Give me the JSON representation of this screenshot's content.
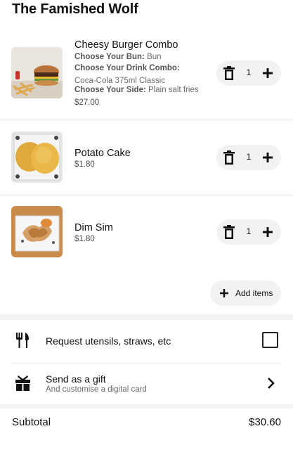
{
  "store": {
    "title": "The Famished Wolf"
  },
  "cart": {
    "items": [
      {
        "name": "Cheesy Burger Combo",
        "options": [
          {
            "label": "Choose Your Bun:",
            "value": "Bun"
          },
          {
            "label": "Choose Your Drink Combo:",
            "value": "Coca-Cola 375ml Classic"
          },
          {
            "label": "Choose Your Side:",
            "value": "Plain salt fries"
          }
        ],
        "price": "$27.00",
        "quantity": "1",
        "image_icon": "burger-photo"
      },
      {
        "name": "Potato Cake",
        "price": "$1.80",
        "quantity": "1",
        "image_icon": "potato-cake-photo"
      },
      {
        "name": "Dim Sim",
        "price": "$1.80",
        "quantity": "1",
        "image_icon": "dim-sim-photo"
      }
    ],
    "add_items_label": "Add items"
  },
  "extras": {
    "utensils": {
      "title": "Request utensils, straws, etc",
      "checked": false,
      "icon": "utensils-icon"
    },
    "gift": {
      "title": "Send as a gift",
      "subtitle": "And customise a digital card",
      "icon": "gift-icon"
    }
  },
  "summary": {
    "subtotal_label": "Subtotal",
    "subtotal_value": "$30.60"
  },
  "colors": {
    "pill_bg": "#f2f2f2",
    "divider": "#e8e8e8",
    "text": "#111111",
    "muted": "#6b6b6b"
  }
}
